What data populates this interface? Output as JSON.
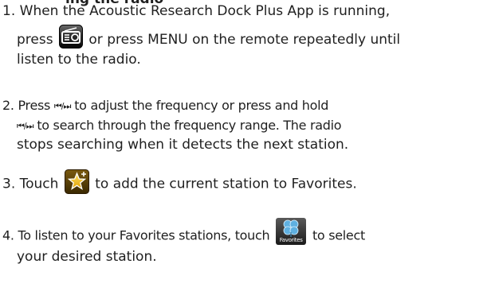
{
  "heading_partial": "ing the radio",
  "steps": [
    {
      "number": "1.",
      "line1": "When the Acoustic Research Dock Plus App is running,",
      "pre_icon": "press",
      "post_icon": "or press MENU on the remote repeatedly until",
      "line3": "listen to the radio.",
      "icon": "radio-app-icon"
    },
    {
      "number": "2.",
      "pre1": "Press",
      "post1": "to adjust the frequency or press and hold",
      "post2": "to search through the frequency range. The radio",
      "line3": "stops searching when it detects the next station.",
      "symbol": "⏮/⏭"
    },
    {
      "number": "3.",
      "pre_icon": "Touch",
      "post_icon": "to add the current station to Favorites.",
      "icon": "star-add-icon"
    },
    {
      "number": "4.",
      "pre_icon": "To listen to your Favorites stations, touch",
      "post_icon": "to select",
      "line2": "your desired station.",
      "icon": "favorites-icon",
      "icon_label": "Favorites"
    }
  ]
}
